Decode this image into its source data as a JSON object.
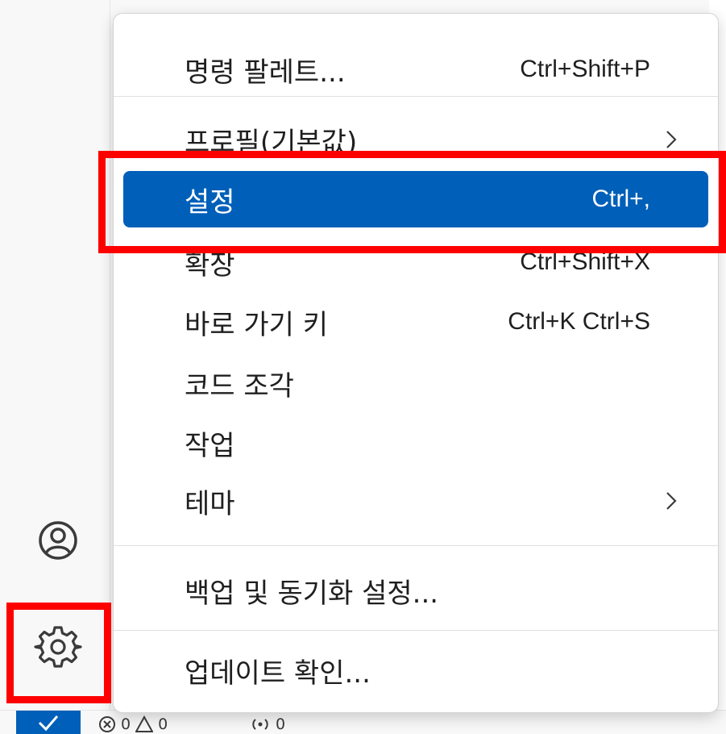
{
  "menu": {
    "items": [
      {
        "label": "명령 팔레트...",
        "shortcut": "Ctrl+Shift+P"
      },
      {
        "label": "프로필(기본값)",
        "shortcut": ""
      },
      {
        "label": "설정",
        "shortcut": "Ctrl+,"
      },
      {
        "label": "확장",
        "shortcut": "Ctrl+Shift+X"
      },
      {
        "label": "바로 가기 키",
        "shortcut": "Ctrl+K Ctrl+S"
      },
      {
        "label": "코드 조각",
        "shortcut": ""
      },
      {
        "label": "작업",
        "shortcut": ""
      },
      {
        "label": "테마",
        "shortcut": ""
      },
      {
        "label": "백업 및 동기화 설정...",
        "shortcut": ""
      },
      {
        "label": "업데이트 확인...",
        "shortcut": ""
      }
    ]
  },
  "status_bar": {
    "errors": "0",
    "warnings": "0",
    "ports": "0"
  },
  "colors": {
    "accent": "#005fb8",
    "annotation": "#ff0000"
  },
  "icons": {
    "accounts": "account-icon",
    "manage": "gear-icon",
    "submenu": "chevron-right-icon",
    "remote": "check-icon"
  }
}
